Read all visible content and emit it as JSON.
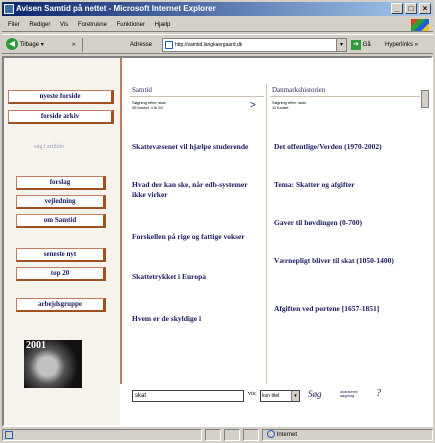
{
  "window": {
    "title": "Avisen Samtid på nettet - Microsoft Internet Explorer",
    "buttons": [
      "_",
      "□",
      "×"
    ]
  },
  "menu": [
    "Filer",
    "Rediger",
    "Vis",
    "Foretrukne",
    "Funktioner",
    "Hjælp"
  ],
  "toolbar": {
    "back_label": "Tilbage",
    "address_label": "Adresse",
    "address_value": "http://samtid.langkaergaard.dk",
    "go_label": "Gå",
    "links_label": "Hyperlinks"
  },
  "sidebar": {
    "items": [
      "nyeste forside",
      "forside arkiv",
      "søg i artikler",
      "forslag",
      "vejledning",
      "om Samtid",
      "seneste nyt",
      "top 20",
      "arbejdsgruppe"
    ],
    "logo_text": "2001"
  },
  "columns": [
    {
      "heading": "Samtid",
      "sort_line1": "Søgning efter: skat.",
      "sort_line2": "45 fundet.   1 til 20",
      "articles": [
        "Skattevæsenet vil hjælpe studerende",
        "Hvad der kan ske, når edb-systemer ikke virker",
        "Forskellen på rige og fattige vokser",
        "Skattetrykket i Europa",
        "Hvem er de skyldige i"
      ]
    },
    {
      "heading": "Danmarkshistorien",
      "sort_line1": "Søgning efter: skat.",
      "sort_line2": "11 fundet.",
      "articles": [
        "Det offentlige/Verden (1970-2002)",
        "Tema: Skatter og afgifter",
        "Gaver til høvdingen (0-700)",
        "Værnepligt bliver til skat (1050-1400)",
        "Afgiften ved portene [1657-1851]"
      ]
    }
  ],
  "search": {
    "query": "skat",
    "vis_label": "vis:",
    "scope_value": "kun titel",
    "search_button": "Søg",
    "advanced_label": "avanceret søgning",
    "help_label": "?"
  },
  "statusbar": {
    "zone": "Internet"
  }
}
